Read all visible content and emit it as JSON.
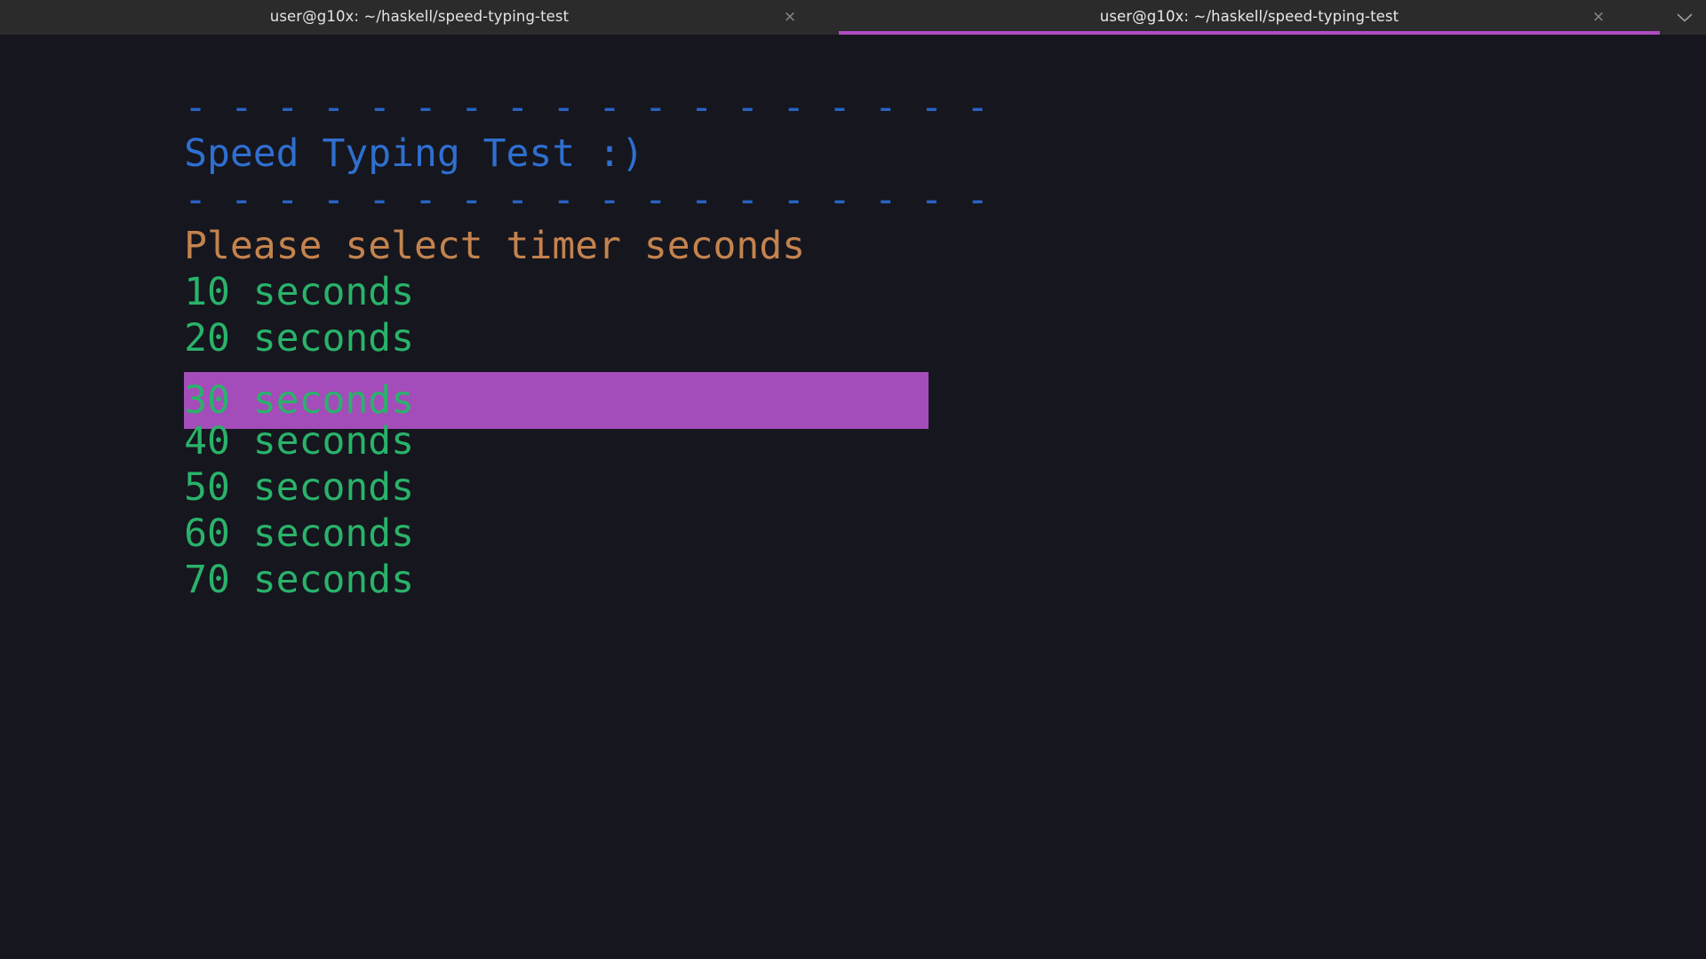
{
  "window": {
    "background": "#16161e",
    "tabbar_background": "#2b2b2b",
    "accent": "#b34bc4"
  },
  "tabbar": {
    "tabs": [
      {
        "title": "user@g10x: ~/haskell/speed-typing-test",
        "active": false,
        "close_icon": "×"
      },
      {
        "title": "user@g10x: ~/haskell/speed-typing-test",
        "active": true,
        "close_icon": "×"
      }
    ],
    "menu_icon": "chevron-down-icon"
  },
  "terminal": {
    "colors": {
      "rule": "#2763c4",
      "title": "#2f6fd0",
      "prompt": "#c4834e",
      "item": "#29b36a",
      "selection_bg": "#a44cba"
    },
    "rule_top": "- - - - - - - - - - - - - - - - - -",
    "title": "Speed Typing Test :)",
    "rule_bottom": "- - - - - - - - - - - - - - - - - -",
    "prompt": "Please select timer seconds",
    "menu_items": [
      {
        "label": "10 seconds",
        "selected": false
      },
      {
        "label": "20 seconds",
        "selected": false
      },
      {
        "label": "30 seconds",
        "selected": true
      },
      {
        "label": "40 seconds",
        "selected": false
      },
      {
        "label": "50 seconds",
        "selected": false
      },
      {
        "label": "60 seconds",
        "selected": false
      },
      {
        "label": "70 seconds",
        "selected": false
      }
    ]
  }
}
